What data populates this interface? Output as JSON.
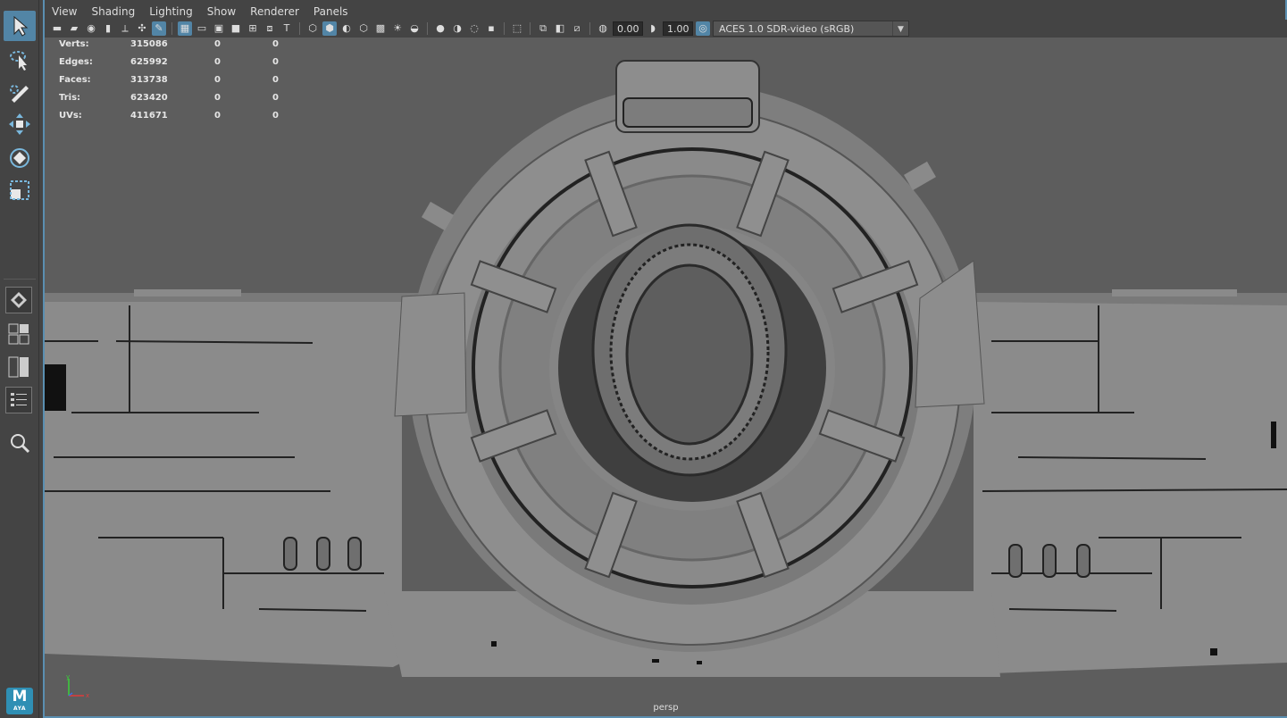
{
  "menu": [
    "View",
    "Shading",
    "Lighting",
    "Show",
    "Renderer",
    "Panels"
  ],
  "toolbox": {
    "tools": [
      "select-tool-icon",
      "lasso-select-icon",
      "paint-select-icon",
      "move-tool-icon",
      "rotate-tool-icon",
      "scale-tool-icon"
    ],
    "layouts": [
      "single-pane-layout-icon",
      "four-pane-layout-icon",
      "two-pane-layout-icon",
      "outliner-layout-icon"
    ],
    "search_icon": "magnifier-icon",
    "logo_main": "M",
    "logo_sub": "AYA"
  },
  "view_toolbar": {
    "exposure": "0.00",
    "gamma": "1.00",
    "color_space": "ACES 1.0 SDR-video (sRGB)"
  },
  "hud": {
    "rows": [
      {
        "label": "Verts:",
        "v1": "315086",
        "v2": "0",
        "v3": "0"
      },
      {
        "label": "Edges:",
        "v1": "625992",
        "v2": "0",
        "v3": "0"
      },
      {
        "label": "Faces:",
        "v1": "313738",
        "v2": "0",
        "v3": "0"
      },
      {
        "label": "Tris:",
        "v1": "623420",
        "v2": "0",
        "v3": "0"
      },
      {
        "label": "UVs:",
        "v1": "411671",
        "v2": "0",
        "v3": "0"
      }
    ]
  },
  "camera": "persp",
  "colors": {
    "accent": "#5285a6",
    "viewport_bg": "#5d5d5d",
    "mesh": "#8c8c8c"
  }
}
